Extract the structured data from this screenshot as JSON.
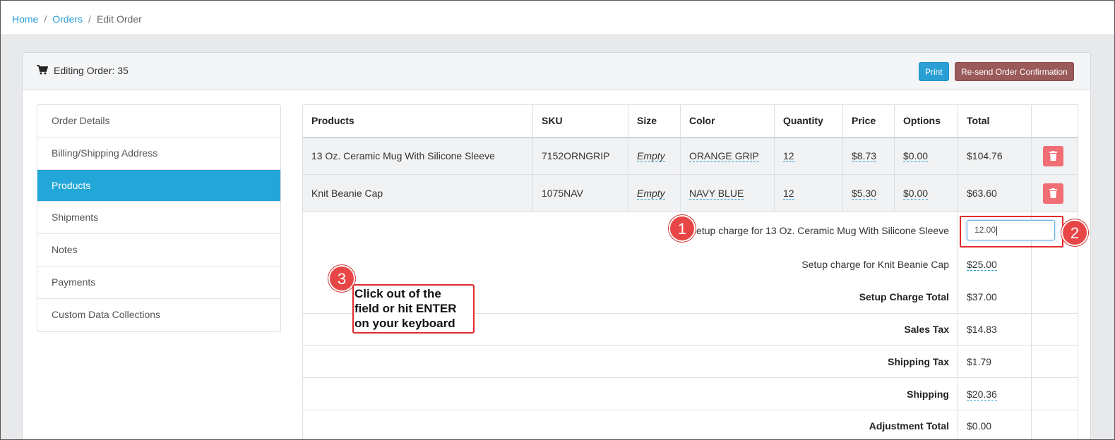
{
  "breadcrumb": {
    "items": [
      {
        "label": "Home"
      },
      {
        "label": "Orders"
      },
      {
        "label": "Edit Order"
      }
    ],
    "separator": "/"
  },
  "panel": {
    "title": "Editing Order: 35",
    "print_label": "Print",
    "resend_label": "Re-send Order Confirmation"
  },
  "sidebar": {
    "items": [
      {
        "label": "Order Details",
        "active": false
      },
      {
        "label": "Billing/Shipping Address",
        "active": false
      },
      {
        "label": "Products",
        "active": true
      },
      {
        "label": "Shipments",
        "active": false
      },
      {
        "label": "Notes",
        "active": false
      },
      {
        "label": "Payments",
        "active": false
      },
      {
        "label": "Custom Data Collections",
        "active": false
      }
    ]
  },
  "table": {
    "columns": [
      "Products",
      "SKU",
      "Size",
      "Color",
      "Quantity",
      "Price",
      "Options",
      "Total"
    ],
    "rows": [
      {
        "product": "13 Oz. Ceramic Mug With Silicone Sleeve",
        "sku": "7152ORNGRIP",
        "size": "Empty",
        "color": "ORANGE GRIP",
        "quantity": "12",
        "price": "$8.73",
        "options": "$0.00",
        "total": "$104.76"
      },
      {
        "product": "Knit Beanie Cap",
        "sku": "1075NAV",
        "size": "Empty",
        "color": "NAVY BLUE",
        "quantity": "12",
        "price": "$5.30",
        "options": "$0.00",
        "total": "$63.60"
      }
    ]
  },
  "summary": {
    "setup_mug_label": "Setup charge for 13 Oz. Ceramic Mug With Silicone Sleeve",
    "setup_mug_value": "12.00",
    "setup_beanie_label": "Setup charge for Knit Beanie Cap",
    "setup_beanie_value": "$25.00",
    "setup_total_label": "Setup Charge Total",
    "setup_total_value": "$37.00",
    "sales_tax_label": "Sales Tax",
    "sales_tax_value": "$14.83",
    "shipping_tax_label": "Shipping Tax",
    "shipping_tax_value": "$1.79",
    "shipping_label": "Shipping",
    "shipping_value": "$20.36",
    "adjustment_label": "Adjustment Total",
    "adjustment_value": "$0.00"
  },
  "annotations": {
    "badge1": "1",
    "badge2": "2",
    "badge3": "3",
    "callout_line1": "Click out of the",
    "callout_line2": "field or hit ENTER",
    "callout_line3": "on your keyboard",
    "badge_color": "#e84646",
    "box_color": "#e32b2b"
  },
  "colors": {
    "accent": "#2a9fd6",
    "active_nav": "#23a6d8",
    "resend_button": "#9a5a59",
    "delete_button": "#f06e74"
  }
}
